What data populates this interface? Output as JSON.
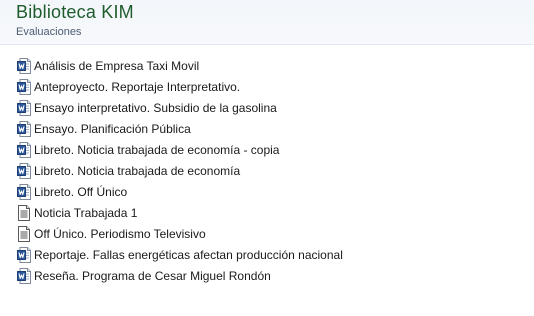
{
  "library": {
    "title": "Biblioteca KIM",
    "subtitle": "Evaluaciones"
  },
  "colors": {
    "title": "#1e5c2c",
    "word_icon": "#2b579a",
    "text_icon": "#5a5a5a"
  },
  "files": [
    {
      "name": "Análisis de Empresa Taxi Movil",
      "icon": "word-document-icon"
    },
    {
      "name": "Anteproyecto. Reportaje Interpretativo.",
      "icon": "word-document-icon"
    },
    {
      "name": "Ensayo interpretativo. Subsidio de la gasolina",
      "icon": "word-document-icon"
    },
    {
      "name": "Ensayo. Planificación Pública",
      "icon": "word-document-icon"
    },
    {
      "name": "Libreto. Noticia trabajada de economía - copia",
      "icon": "word-document-icon"
    },
    {
      "name": "Libreto. Noticia trabajada de economía",
      "icon": "word-document-icon"
    },
    {
      "name": "Libreto. Off Único",
      "icon": "word-document-icon"
    },
    {
      "name": "Noticia Trabajada 1",
      "icon": "text-document-icon"
    },
    {
      "name": "Off Único. Periodismo Televisivo",
      "icon": "text-document-icon"
    },
    {
      "name": "Reportaje. Fallas energéticas afectan producción nacional",
      "icon": "word-document-icon"
    },
    {
      "name": "Reseña. Programa de Cesar Miguel Rondón",
      "icon": "word-document-icon"
    }
  ]
}
